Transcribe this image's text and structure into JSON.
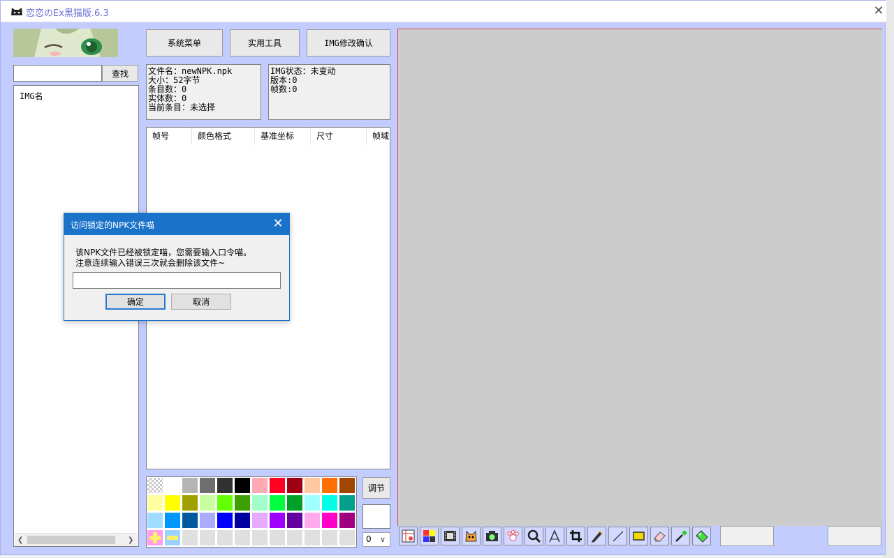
{
  "window": {
    "title": "恋恋のEx黑猫版.6.3"
  },
  "search": {
    "button_label": "查找",
    "value": ""
  },
  "img_list": {
    "header": "IMG名"
  },
  "toolbar": {
    "system_menu": "系统菜单",
    "tools": "实用工具",
    "img_confirm": "IMG修改确认"
  },
  "file_info": {
    "lines": [
      "文件名：newNPK.npk",
      "大小：52字节",
      "条目数：0",
      "实体数：0",
      "当前条目：未选择"
    ]
  },
  "img_info": {
    "lines": [
      "IMG状态：未变动",
      "版本:0",
      "帧数:0"
    ]
  },
  "frame_table": {
    "columns": [
      "帧号",
      "颜色格式",
      "基准坐标",
      "尺寸",
      "帧域"
    ]
  },
  "palette": {
    "rows": [
      [
        "checker",
        "#ffffff",
        "#b4b4b4",
        "#6e6e6e",
        "#323232",
        "#000000",
        "#ffaab4",
        "#ff0022",
        "#a00014",
        "#ffc8a0",
        "#ff7000",
        "#a04600"
      ],
      [
        "#ffffa0",
        "#ffff00",
        "#a0a000",
        "#c8ffa0",
        "#64ff00",
        "#3ca000",
        "#a0ffc8",
        "#00ff3c",
        "#00a028",
        "#a0ffff",
        "#00ffe6",
        "#00a08c"
      ],
      [
        "#a0dcff",
        "#0096ff",
        "#005aa0",
        "#aaaaff",
        "#0000ff",
        "#0000a0",
        "#e6aaff",
        "#a000ff",
        "#6400a0",
        "#ffaaee",
        "#ff00c8",
        "#a0007d"
      ],
      [
        "add",
        "remove",
        "hatch",
        "hatch",
        "hatch",
        "hatch",
        "hatch",
        "hatch",
        "hatch",
        "hatch",
        "hatch",
        "hatch"
      ]
    ]
  },
  "side": {
    "adjust_label": "调节",
    "alpha_value": "0"
  },
  "tools": [
    "frame-sheet-icon",
    "palette-grid-icon",
    "film-strip-icon",
    "cat-face-icon",
    "camera-icon",
    "paw-icon",
    "magnifier-icon",
    "measure-icon",
    "crop-icon",
    "pencil-icon",
    "line-icon",
    "rectangle-icon",
    "eraser-icon",
    "eyedropper-icon",
    "tag-icon"
  ],
  "dialog": {
    "title": "访问锁定的NPK文件喵",
    "message_line1": "该NPK文件已经被锁定喵，您需要输入口令喵。",
    "message_line2": "注意连续输入错误三次就会删除该文件~",
    "input_value": "",
    "ok_label": "确定",
    "cancel_label": "取消"
  },
  "colors": {
    "window_bg": "#c2ccff",
    "dialog_accent": "#1a73c8",
    "canvas_bg": "#cccccc",
    "title_text": "#6b6fd8"
  }
}
